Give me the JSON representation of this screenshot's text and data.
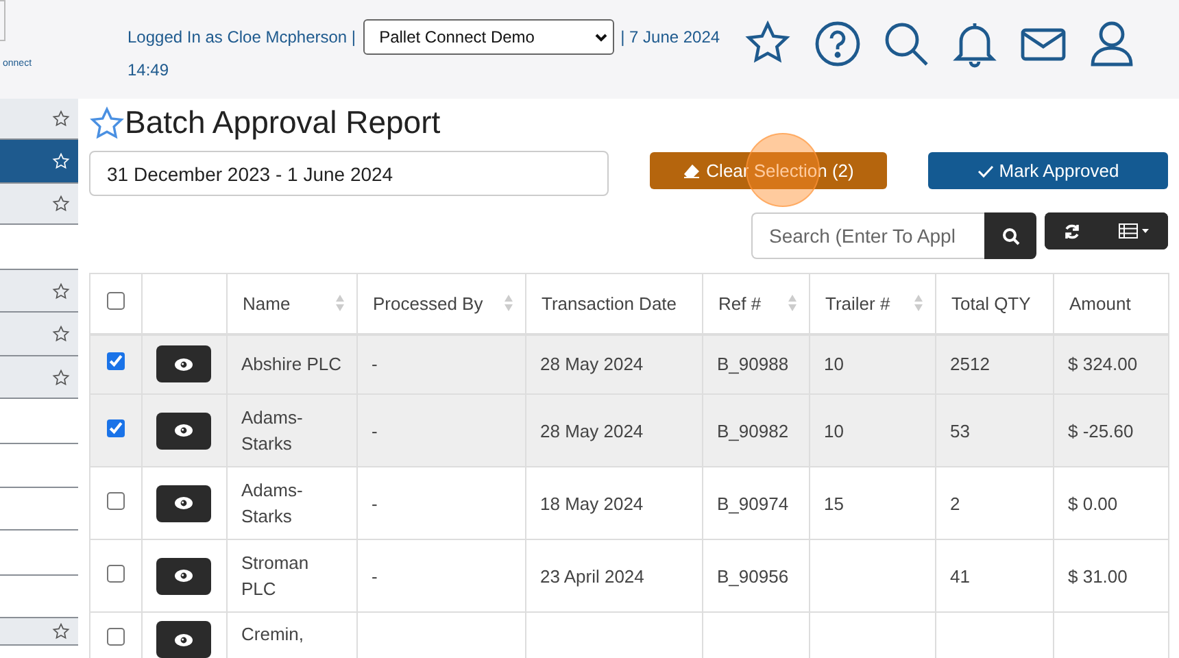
{
  "logo": {
    "text": "onnect"
  },
  "header": {
    "user_text": "Logged In as Cloe Mcpherson |",
    "company_select": {
      "value": "Pallet Connect Demo"
    },
    "date_text": "| 7 June 2024",
    "time_text": "14:49"
  },
  "sidebar": {
    "items": [
      {
        "starred": true,
        "selected": false
      },
      {
        "starred": true,
        "selected": true
      },
      {
        "starred": true,
        "selected": false
      },
      {
        "starred": false,
        "selected": false
      },
      {
        "starred": true,
        "selected": false
      },
      {
        "starred": true,
        "selected": false
      },
      {
        "starred": true,
        "selected": false
      },
      {
        "starred": false,
        "selected": false
      },
      {
        "starred": false,
        "selected": false
      },
      {
        "starred": false,
        "selected": false
      },
      {
        "starred": false,
        "selected": false
      },
      {
        "starred": false,
        "selected": false
      },
      {
        "starred": true,
        "selected": false
      }
    ]
  },
  "page": {
    "title": "Batch Approval Report",
    "date_range": "31 December 2023 - 1 June 2024",
    "clear_button": "Clear Selection (2)",
    "approve_button": "Mark Approved",
    "search": {
      "placeholder": "Search (Enter To Appl"
    }
  },
  "table": {
    "columns": [
      {
        "label": "Name",
        "sortable": true
      },
      {
        "label": "Processed By",
        "sortable": true
      },
      {
        "label": "Transaction Date",
        "sortable": false
      },
      {
        "label": "Ref #",
        "sortable": true
      },
      {
        "label": "Trailer #",
        "sortable": true
      },
      {
        "label": "Total QTY",
        "sortable": false
      },
      {
        "label": "Amount",
        "sortable": false
      }
    ],
    "all_checked": false,
    "rows": [
      {
        "checked": true,
        "cells": [
          "Abshire PLC",
          "-",
          "28 May 2024",
          "B_90988",
          "10",
          "2512",
          "$ 324.00"
        ]
      },
      {
        "checked": true,
        "cells": [
          "Adams-Starks",
          "-",
          "28 May 2024",
          "B_90982",
          "10",
          "53",
          "$ -25.60"
        ]
      },
      {
        "checked": false,
        "cells": [
          "Adams-Starks",
          "-",
          "18 May 2024",
          "B_90974",
          "15",
          "2",
          "$ 0.00"
        ]
      },
      {
        "checked": false,
        "cells": [
          "Stroman PLC",
          "-",
          "23 April 2024",
          "B_90956",
          "",
          "41",
          "$ 31.00"
        ]
      },
      {
        "checked": false,
        "cells": [
          "Cremin,",
          "",
          "",
          "",
          "",
          "",
          ""
        ]
      }
    ]
  }
}
